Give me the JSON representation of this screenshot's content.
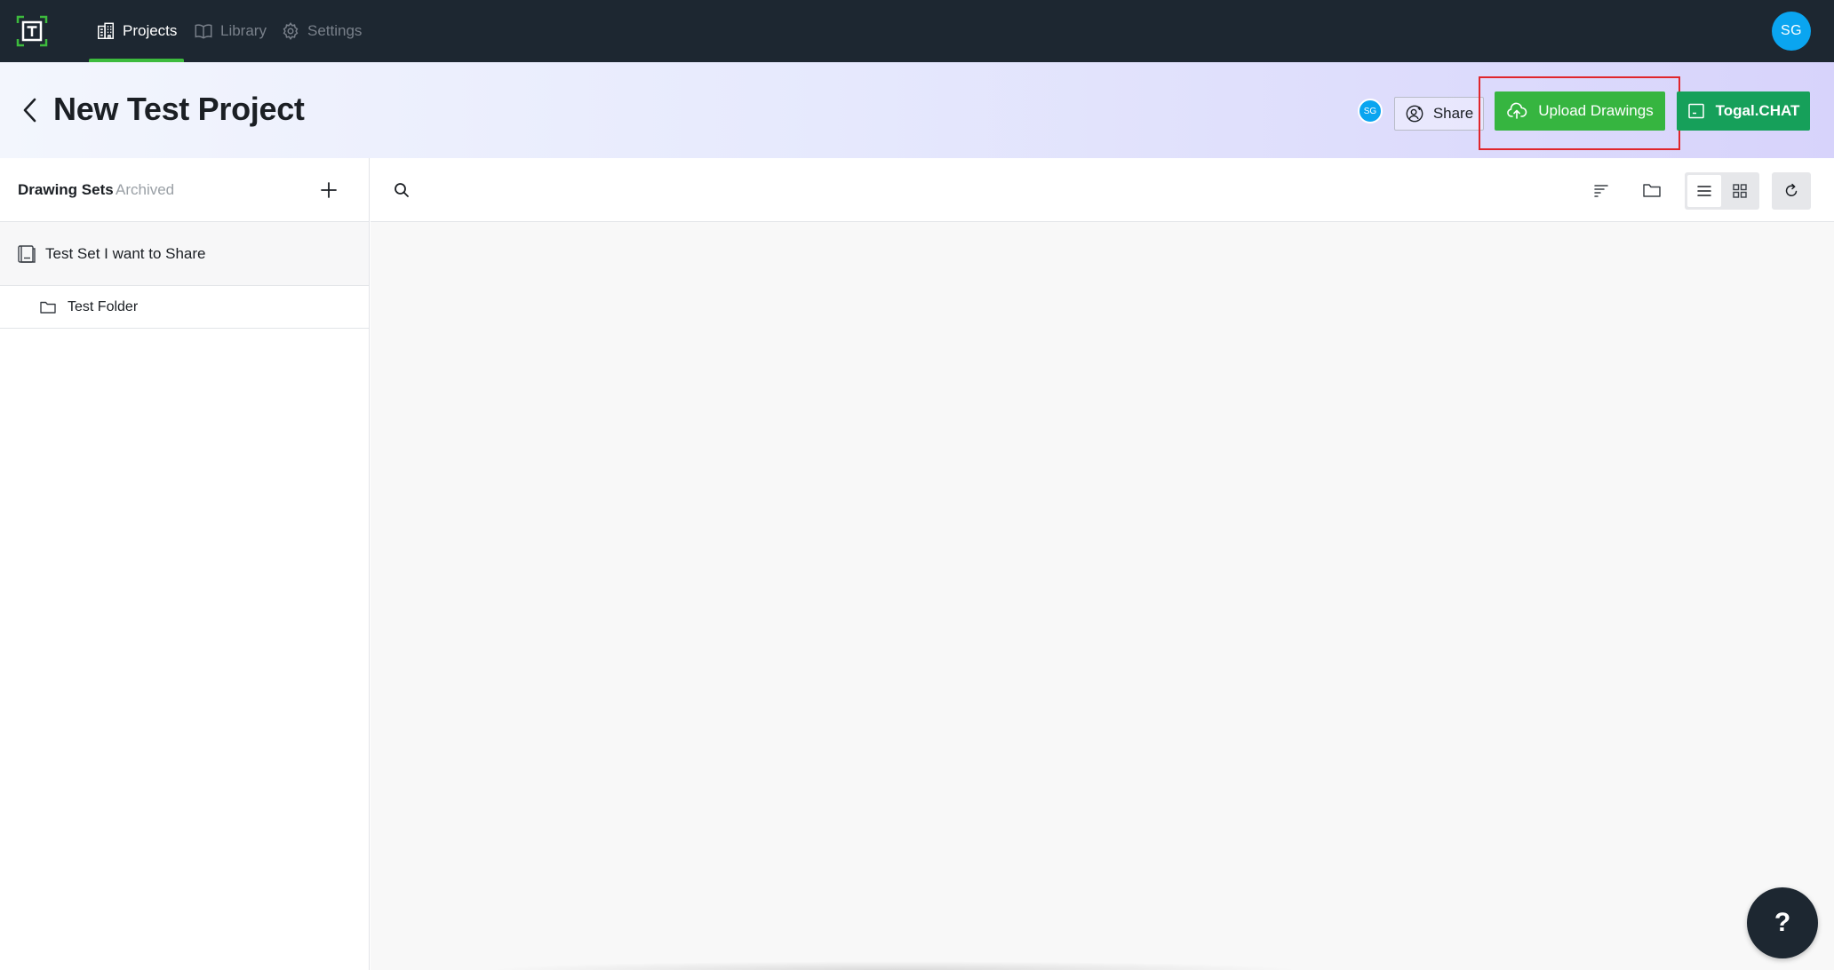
{
  "topnav": {
    "items": [
      {
        "label": "Projects",
        "icon": "building-icon",
        "active": true
      },
      {
        "label": "Library",
        "icon": "book-icon",
        "active": false
      },
      {
        "label": "Settings",
        "icon": "gear-icon",
        "active": false
      }
    ],
    "avatar_initials": "SG",
    "active_color": "#3dbb3d",
    "background": "#1d2731"
  },
  "header": {
    "title": "New Test Project",
    "member_initials": "SG",
    "share_label": "Share",
    "upload_label": "Upload Drawings",
    "chat_label": "Togal.CHAT",
    "upload_color": "#36b540",
    "chat_color": "#16a05a",
    "highlight_color": "#e0262c"
  },
  "sidebar": {
    "tabs": [
      "Drawing Sets",
      "Archived"
    ],
    "items": [
      {
        "label": "Test Set I want to Share",
        "icon": "drawing-set-icon"
      },
      {
        "label": "Test Folder",
        "icon": "folder-icon"
      }
    ]
  },
  "help": {
    "label": "?"
  }
}
